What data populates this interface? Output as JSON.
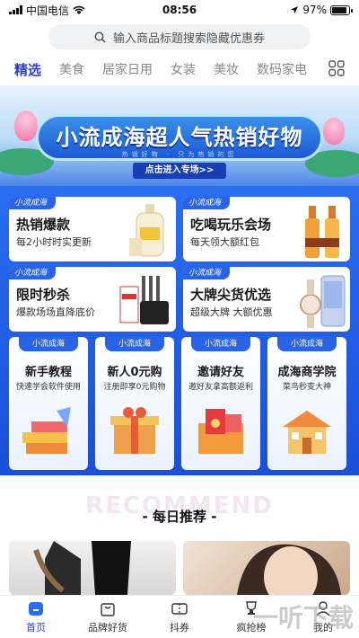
{
  "status_bar": {
    "carrier": "中国电信",
    "time": "08:56",
    "battery": "97%"
  },
  "search": {
    "placeholder": "输入商品标题搜索隐藏优惠券"
  },
  "tabs": [
    {
      "label": "精选",
      "active": true
    },
    {
      "label": "美食",
      "active": false
    },
    {
      "label": "居家日用",
      "active": false
    },
    {
      "label": "女装",
      "active": false
    },
    {
      "label": "美妆",
      "active": false
    },
    {
      "label": "数码家电",
      "active": false
    }
  ],
  "hero": {
    "title": "小流成海超人气热销好物",
    "subtitle": "热销好物 · 只为热销的您",
    "cta": "点击进入专场>>"
  },
  "promo": {
    "brand": "小流成海",
    "large_cards": [
      {
        "title": "热销爆款",
        "subtitle": "每2小时时实更新"
      },
      {
        "title": "吃喝玩乐会场",
        "subtitle": "每天领大额红包"
      },
      {
        "title": "限时秒杀",
        "subtitle": "爆款场场直降底价"
      },
      {
        "title": "大牌尖货优选",
        "subtitle": "超级大牌 大额优惠"
      }
    ],
    "small_cards": [
      {
        "title": "新手教程",
        "subtitle": "快速学会软件使用"
      },
      {
        "title": "新人0元购",
        "subtitle": "注册即享0元购物"
      },
      {
        "title": "邀请好友",
        "subtitle": "邀好友拿高额返利"
      },
      {
        "title": "成海商学院",
        "subtitle": "菜鸟秒变大神"
      }
    ]
  },
  "recommend": {
    "bg_text": "RECOMMEND",
    "title": "- 每日推荐 -"
  },
  "tabbar": [
    {
      "label": "首页",
      "icon": "home-icon",
      "active": true
    },
    {
      "label": "品牌好货",
      "icon": "bag-icon",
      "active": false
    },
    {
      "label": "抖券",
      "icon": "ticket-icon",
      "active": false
    },
    {
      "label": "疯抢榜",
      "icon": "trophy-icon",
      "active": false
    },
    {
      "label": "我的",
      "icon": "user-icon",
      "active": false
    }
  ],
  "watermark": "一听下载",
  "colors": {
    "accent": "#2b3fd6",
    "panel": "#1f5ce6"
  }
}
